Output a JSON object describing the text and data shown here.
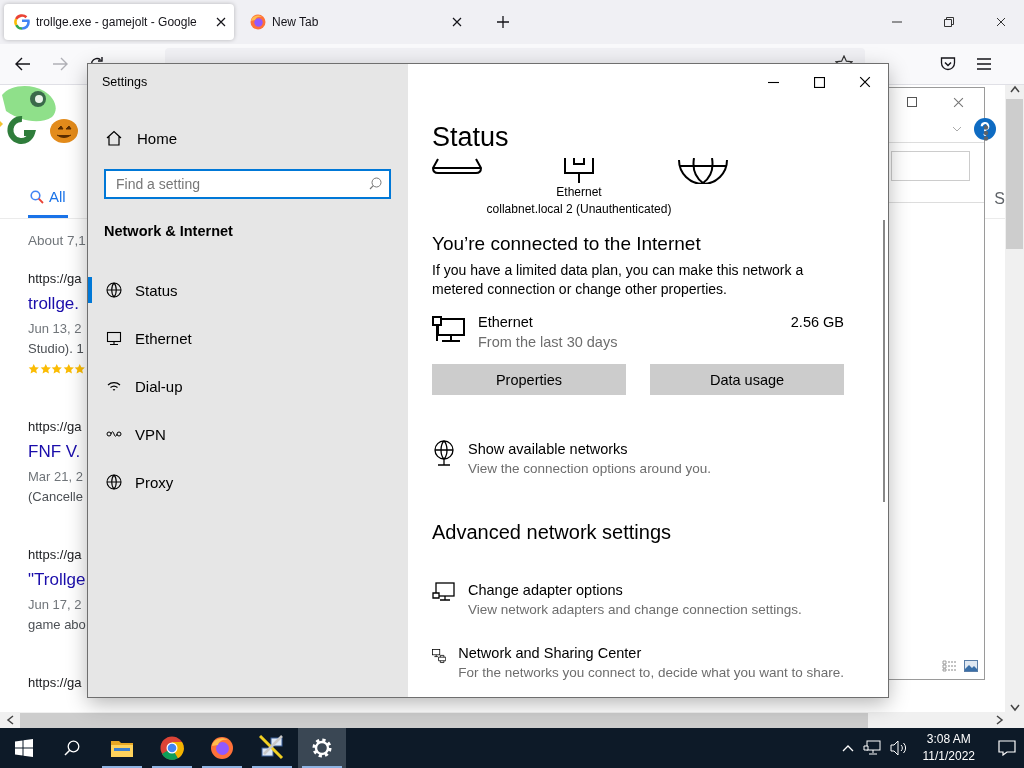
{
  "browser": {
    "tabs": [
      {
        "label": "trollge.exe - gamejolt - Google",
        "selected": true
      },
      {
        "label": "New Tab",
        "selected": false
      }
    ],
    "page": {
      "search_tab": "All",
      "side_text": "S",
      "result_count": "About 7,1",
      "results": [
        {
          "url": "https://ga",
          "title": "trollge.",
          "lines": [
            "Jun 13, 2",
            "Studio). 1"
          ],
          "stars": 5
        },
        {
          "url": "https://ga",
          "title": "FNF V.",
          "lines": [
            "Mar 21, 2",
            "(Cancelle"
          ]
        },
        {
          "url": "https://ga",
          "title": "\"Trollge",
          "lines": [
            "Jun 17, 2",
            "game abo"
          ]
        },
        {
          "url": "https://ga"
        }
      ]
    }
  },
  "settings": {
    "title": "Settings",
    "home": "Home",
    "search_placeholder": "Find a setting",
    "section": "Network & Internet",
    "nav": [
      {
        "label": "Status",
        "selected": true
      },
      {
        "label": "Ethernet",
        "selected": false
      },
      {
        "label": "Dial-up",
        "selected": false
      },
      {
        "label": "VPN",
        "selected": false
      },
      {
        "label": "Proxy",
        "selected": false
      }
    ],
    "heading": "Status",
    "diagram": {
      "adapter": "Ethernet",
      "network": "collabnet.local 2 (Unauthenticated)"
    },
    "connection_title": "You’re connected to the Internet",
    "connection_text": "If you have a limited data plan, you can make this network a metered connection or change other properties.",
    "usage": {
      "name": "Ethernet",
      "period": "From the last 30 days",
      "amount": "2.56 GB"
    },
    "buttons": [
      "Properties",
      "Data usage"
    ],
    "links": [
      {
        "title": "Show available networks",
        "description": "View the connection options around you."
      }
    ],
    "advanced_heading": "Advanced network settings",
    "advanced": [
      {
        "title": "Change adapter options",
        "description": "View network adapters and change connection settings."
      },
      {
        "title": "Network and Sharing Center",
        "description": "For the networks you connect to, decide what you want to share."
      }
    ]
  },
  "taskbar": {
    "apps": [
      {
        "selected": false,
        "running": true
      },
      {
        "selected": false,
        "running": true
      },
      {
        "selected": false,
        "running": true
      },
      {
        "selected": false,
        "running": true
      },
      {
        "selected": true,
        "running": true
      }
    ],
    "time": "3:08 AM",
    "date": "11/1/2022"
  }
}
